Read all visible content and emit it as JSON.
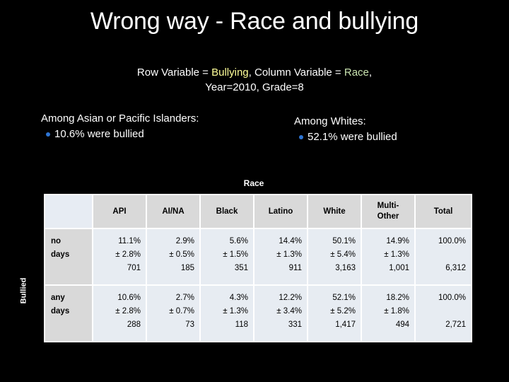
{
  "slide": {
    "title": "Wrong way - Race and bullying",
    "background_color": "#000000",
    "text_color": "#ffffff"
  },
  "subtitle": {
    "line1_prefix": "Row Variable = ",
    "row_variable": "Bullying",
    "line1_middle": ", Column Variable = ",
    "column_variable": "Race",
    "line1_suffix": ",",
    "line2": "Year=2010, Grade=8",
    "row_variable_color": "#ffff99",
    "column_variable_color": "#c9e3b0"
  },
  "bullets": {
    "left": {
      "heading": "Among Asian or Pacific Islanders:",
      "item": "10.6% were bullied"
    },
    "right": {
      "heading": "Among Whites:",
      "item": "52.1% were bullied"
    },
    "bullet_color": "#2e75d4"
  },
  "table": {
    "column_variable_caption": "Race",
    "row_variable_caption": "Bullied",
    "corner_label": "",
    "column_headers": [
      "API",
      "AI/NA",
      "Black",
      "Latino",
      "White",
      "Multi-Other",
      "Total"
    ],
    "column_headers_split": [
      {
        "l1": "API",
        "l2": ""
      },
      {
        "l1": "AI/NA",
        "l2": ""
      },
      {
        "l1": "Black",
        "l2": ""
      },
      {
        "l1": "Latino",
        "l2": ""
      },
      {
        "l1": "White",
        "l2": ""
      },
      {
        "l1": "Multi-",
        "l2": "Other"
      },
      {
        "l1": "Total",
        "l2": ""
      }
    ],
    "rows": [
      {
        "label_l1": "no",
        "label_l2": "days",
        "cells": [
          {
            "pct": "11.1%",
            "moe": "± 2.8%",
            "n": "701"
          },
          {
            "pct": "2.9%",
            "moe": "± 0.5%",
            "n": "185"
          },
          {
            "pct": "5.6%",
            "moe": "± 1.5%",
            "n": "351"
          },
          {
            "pct": "14.4%",
            "moe": "± 1.3%",
            "n": "911"
          },
          {
            "pct": "50.1%",
            "moe": "± 5.4%",
            "n": "3,163"
          },
          {
            "pct": "14.9%",
            "moe": "± 1.3%",
            "n": "1,001"
          },
          {
            "pct": "100.0%",
            "moe": "",
            "n": "6,312"
          }
        ]
      },
      {
        "label_l1": "any",
        "label_l2": "days",
        "cells": [
          {
            "pct": "10.6%",
            "moe": "± 2.8%",
            "n": "288"
          },
          {
            "pct": "2.7%",
            "moe": "± 0.7%",
            "n": "73"
          },
          {
            "pct": "4.3%",
            "moe": "± 1.3%",
            "n": "118"
          },
          {
            "pct": "12.2%",
            "moe": "± 3.4%",
            "n": "331"
          },
          {
            "pct": "52.1%",
            "moe": "± 5.2%",
            "n": "1,417"
          },
          {
            "pct": "18.2%",
            "moe": "± 1.8%",
            "n": "494"
          },
          {
            "pct": "100.0%",
            "moe": "",
            "n": "2,721"
          }
        ]
      }
    ],
    "header_bg": "#d9d9d9",
    "corner_bg": "#e7ecf3",
    "cell_bg": "#e7ecf2",
    "grid_color": "#ffffff"
  }
}
